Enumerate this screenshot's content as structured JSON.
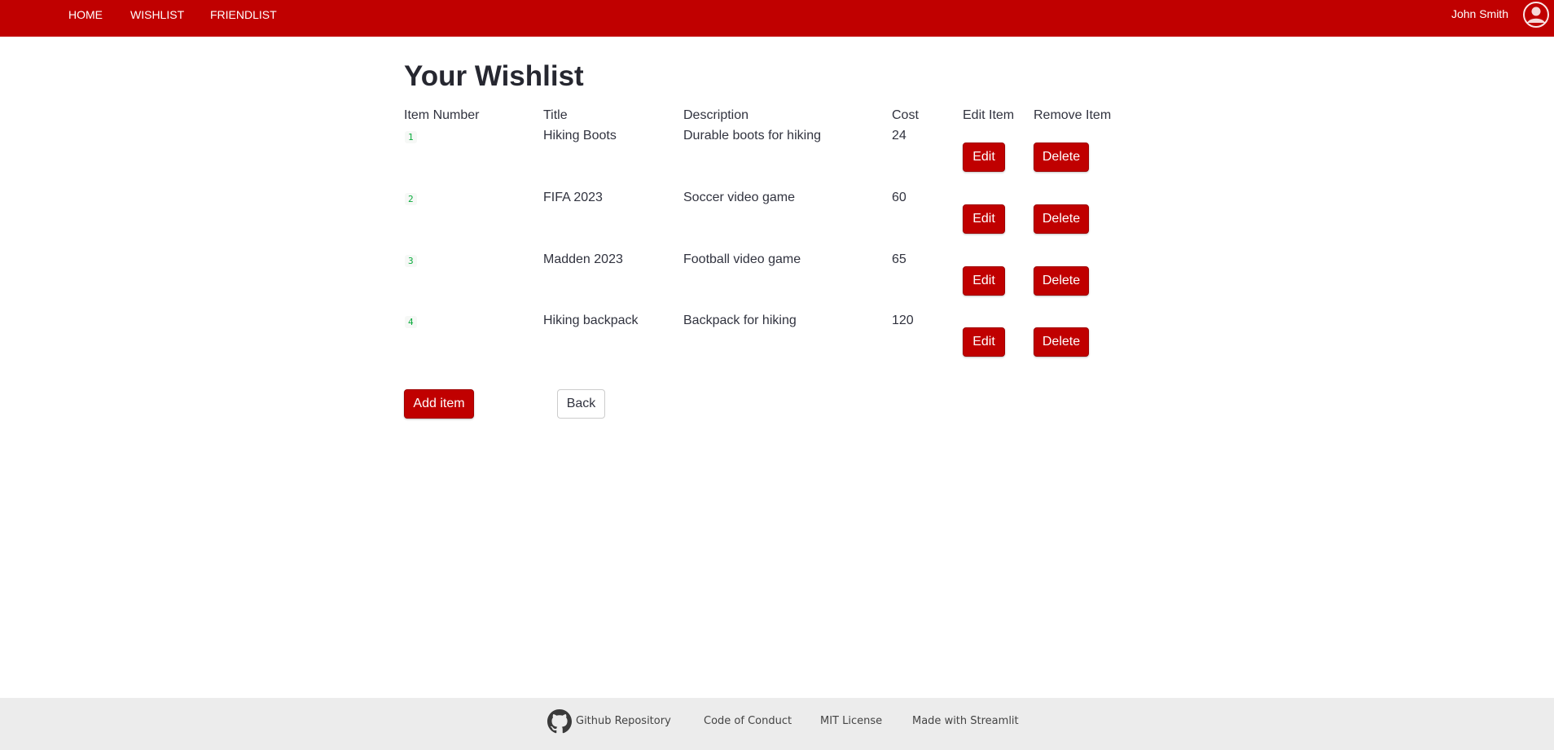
{
  "nav": {
    "links": [
      "HOME",
      "WISHLIST",
      "FRIENDLIST"
    ],
    "user_name": "John Smith",
    "accent": "#c00000"
  },
  "page": {
    "title": "Your Wishlist"
  },
  "table": {
    "headers": [
      "Item Number",
      "Title",
      "Description",
      "Cost",
      "Edit Item",
      "Remove Item"
    ],
    "rows": [
      {
        "number": "1",
        "title": "Hiking Boots",
        "description": "Durable boots for hiking",
        "cost": "24",
        "edit": "Edit",
        "delete": "Delete"
      },
      {
        "number": "2",
        "title": "FIFA 2023",
        "description": "Soccer video game",
        "cost": "60",
        "edit": "Edit",
        "delete": "Delete"
      },
      {
        "number": "3",
        "title": "Madden 2023",
        "description": "Football video game",
        "cost": "65",
        "edit": "Edit",
        "delete": "Delete"
      },
      {
        "number": "4",
        "title": "Hiking backpack",
        "description": "Backpack for hiking",
        "cost": "120",
        "edit": "Edit",
        "delete": "Delete"
      }
    ]
  },
  "actions": {
    "add_label": "Add item",
    "back_label": "Back"
  },
  "footer": {
    "github_icon": "github-icon",
    "links": [
      "Github Repository",
      "Code of Conduct",
      "MIT License",
      "Made with Streamlit"
    ]
  }
}
